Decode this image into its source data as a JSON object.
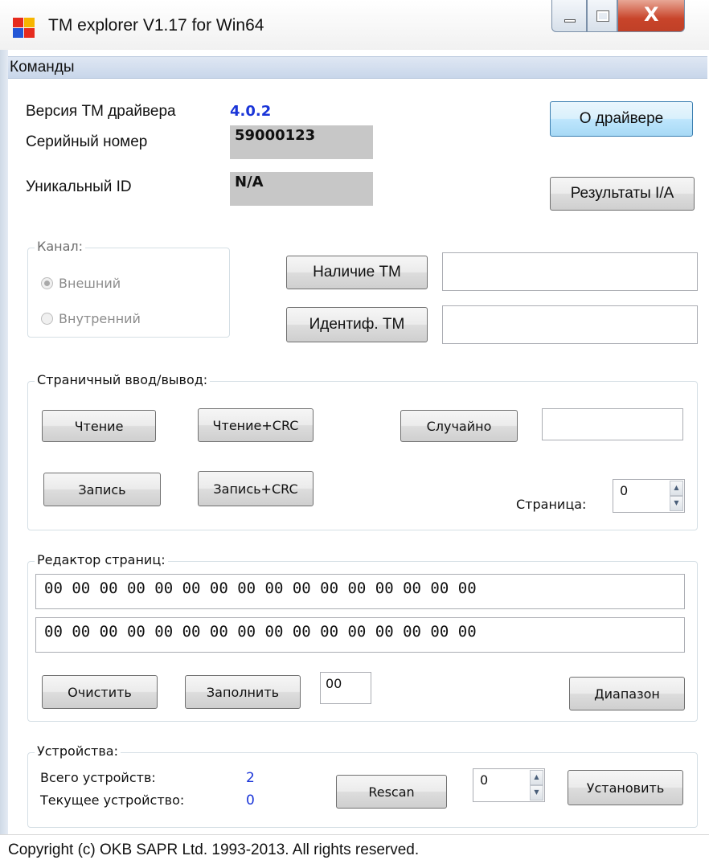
{
  "window": {
    "title": "TM explorer V1.17 for Win64",
    "controls": {
      "close_glyph": "X"
    }
  },
  "menu": {
    "commands": "Команды"
  },
  "info": {
    "driver_version_label": "Версия  ТМ драйвера",
    "driver_version_value": "4.0.2",
    "serial_label": "Серийный номер",
    "serial_value": "59000123",
    "unique_id_label": "Уникальный ID",
    "unique_id_value": "N/A",
    "about_driver_button": "О драйвере",
    "results_button": "Результаты I/A"
  },
  "channel": {
    "title": "Канал:",
    "options": [
      "Внешний",
      "Внутренний"
    ],
    "selected": "Внешний",
    "presence_button": "Наличие ТМ",
    "presence_value": "",
    "identify_button": "Идентиф. ТМ",
    "identify_value": ""
  },
  "page_io": {
    "title": "Страничный ввод/вывод:",
    "read_button": "Чтение",
    "read_crc_button": "Чтение+CRC",
    "random_button": "Случайно",
    "random_value": "",
    "write_button": "Запись",
    "write_crc_button": "Запись+CRC",
    "page_label": "Страница:",
    "page_value": "0"
  },
  "page_editor": {
    "title": "Редактор страниц:",
    "row1": "00  00  00  00  00  00  00  00  00  00  00  00  00  00  00  00",
    "row2": "00  00  00  00  00  00  00  00  00  00  00  00  00  00  00  00",
    "clear_button": "Очистить",
    "fill_button": "Заполнить",
    "fill_value": "00",
    "range_button": "Диапазон"
  },
  "devices": {
    "title": "Устройства:",
    "total_label": "Всего устройств:",
    "total_value": "2",
    "current_label": "Текущее устройство:",
    "current_value": "0",
    "rescan_button": "Rescan",
    "device_index_value": "0",
    "set_button": "Установить"
  },
  "status": {
    "text": "Copyright (c) OKB SAPR Ltd. 1993-2013. All rights reserved."
  },
  "colors": {
    "accent_blue": "#1a35d8",
    "close_red": "#c8442a"
  }
}
